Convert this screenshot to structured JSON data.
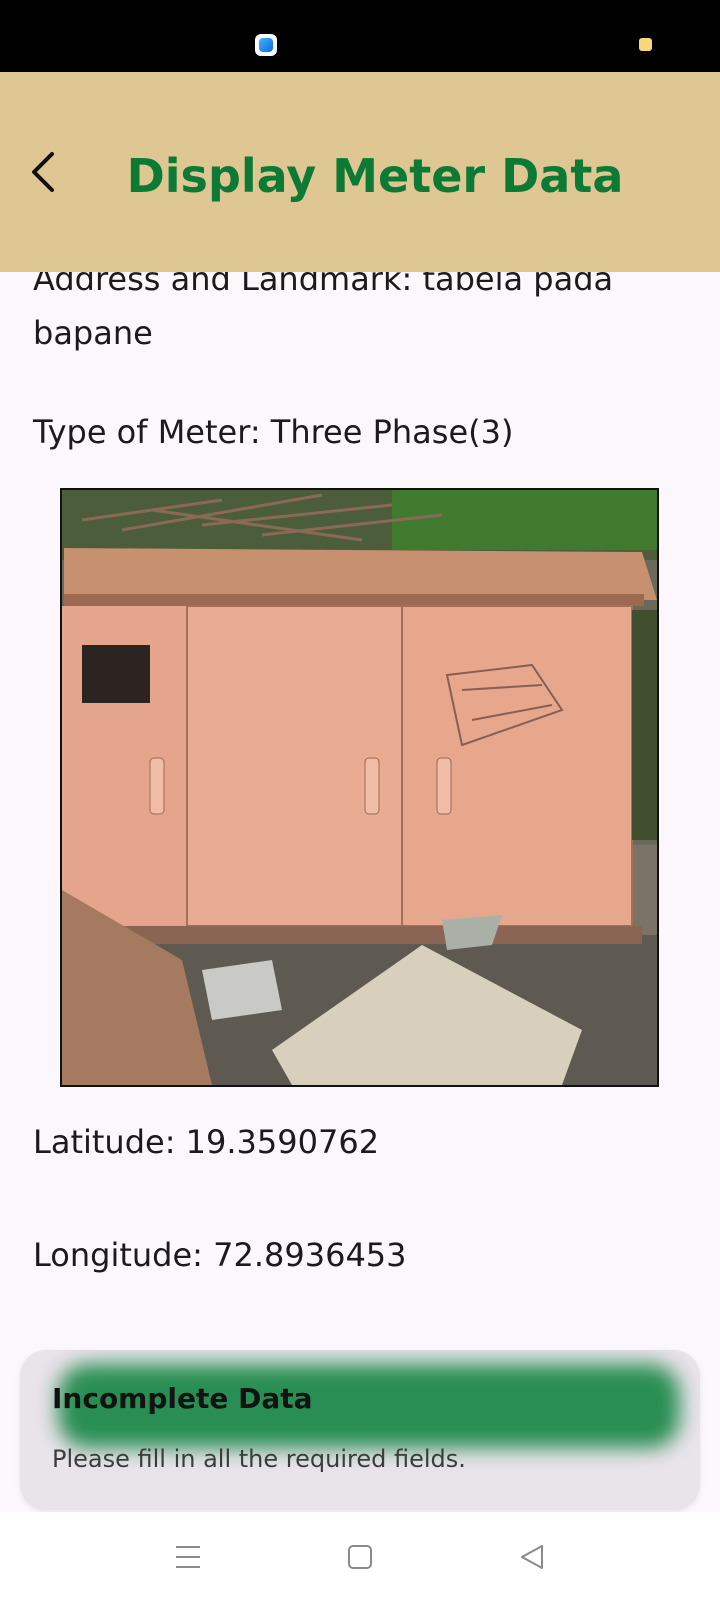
{
  "app_bar": {
    "title": "Display Meter Data",
    "back_icon": "back-arrow-icon"
  },
  "details": {
    "address": "Address and Landmark: tabela pada bapane",
    "meter_type": "Type of Meter: Three Phase(3)",
    "latitude": "Latitude: 19.3590762",
    "longitude": "Longitude: 72.8936453"
  },
  "photo": {
    "description_icon": "meter-cabinet-photo"
  },
  "snackbar": {
    "title": "Incomplete Data",
    "message": "Please fill in all the required fields.",
    "accent_color": "#1f8a4b"
  },
  "nav_bar": {
    "menu_icon": "menu-icon",
    "home_icon": "home-square-icon",
    "back_icon": "back-triangle-icon"
  },
  "colors": {
    "app_bar_bg": "#dec793",
    "title_color": "#0c7a35",
    "page_bg": "#fbf7fc"
  }
}
